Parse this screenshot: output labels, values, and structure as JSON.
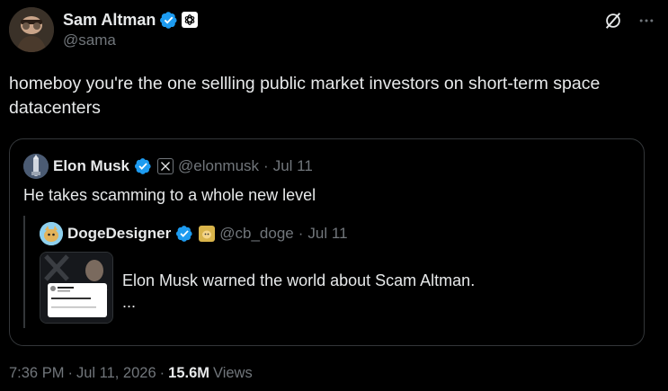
{
  "author": {
    "name": "Sam Altman",
    "handle": "@sama"
  },
  "icons": {
    "verified": "verified-badge-icon",
    "affiliate": "openai-logo-icon",
    "grok": "grok-icon",
    "more": "more-icon"
  },
  "tweet": {
    "text": "homeboy you're the one sellling public market investors on short-term space datacenters"
  },
  "quote": {
    "name": "Elon Musk",
    "handle": "@elonmusk",
    "sep": "·",
    "date": "Jul 11",
    "text": "He takes scamming to a whole new level",
    "nested": {
      "name": "DogeDesigner",
      "handle": "@cb_doge",
      "sep": "·",
      "date": "Jul 11",
      "text": "Elon Musk warned the world about Scam Altman.",
      "ellipsis": "..."
    }
  },
  "meta": {
    "time": "7:36 PM",
    "sep1": "·",
    "date": "Jul 11, 2026",
    "sep2": "·",
    "views": "15.6M",
    "views_label": "Views"
  },
  "colors": {
    "background": "#000000",
    "text": "#e7e9ea",
    "muted": "#71767b",
    "border": "#333639",
    "verified": "#1d9bf0"
  }
}
